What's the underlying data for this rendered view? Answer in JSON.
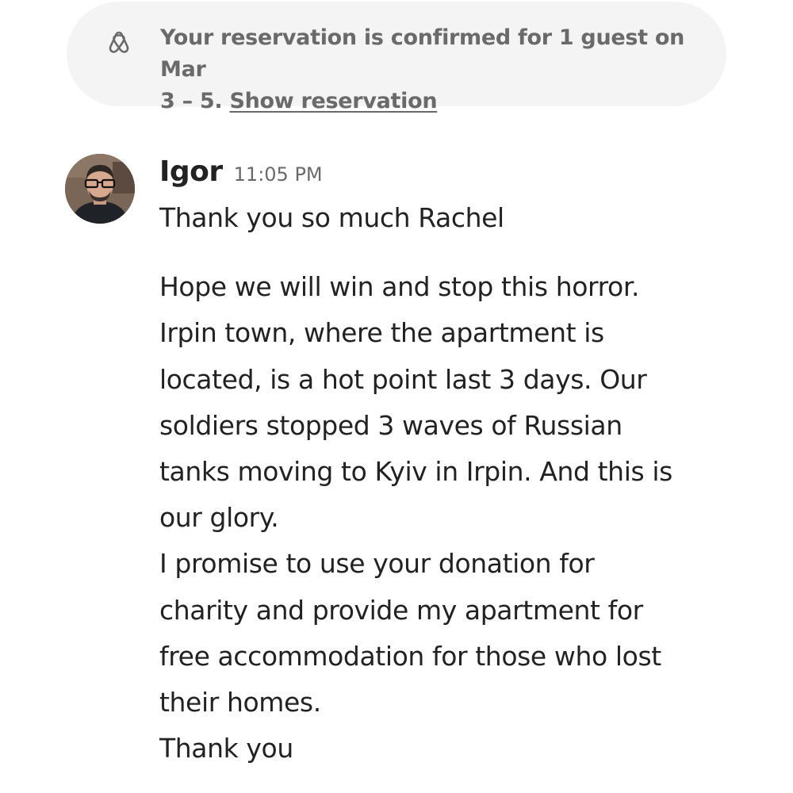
{
  "banner": {
    "icon": "airbnb-logo-icon",
    "text_line1": "Your reservation is confirmed for 1 guest on Mar",
    "text_line2_prefix": "3 – 5. ",
    "link_label": "Show reservation"
  },
  "message": {
    "sender": "Igor",
    "timestamp": "11:05 PM",
    "avatar": "avatar",
    "greeting": "Thank you so much Rachel",
    "lines": [
      "Hope we will win and stop this horror.",
      "Irpin town, where the apartment is",
      "located, is a hot point last 3 days. Our",
      "soldiers stopped 3 waves of Russian",
      "tanks moving to Kyiv in Irpin. And this is",
      "our glory.",
      "I promise to use your donation for",
      "charity and provide my apartment for",
      "free accommodation for those who lost",
      "their homes.",
      "Thank you"
    ]
  },
  "colors": {
    "banner_bg": "#f4f4f4",
    "banner_text": "#6a6a6a",
    "body_text": "#222222"
  }
}
